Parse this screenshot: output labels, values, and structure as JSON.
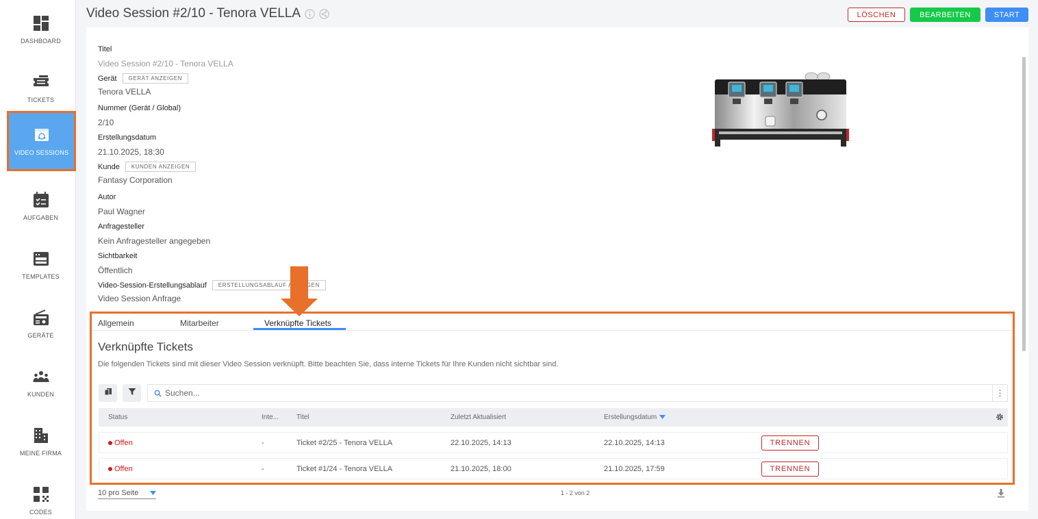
{
  "sidebar": {
    "items": [
      {
        "label": "DASHBOARD",
        "icon": "dashboard-icon"
      },
      {
        "label": "TICKETS",
        "icon": "ticket-icon"
      },
      {
        "label": "VIDEO SESSIONS",
        "icon": "video-session-icon",
        "active": true
      },
      {
        "label": "AUFGABEN",
        "icon": "calendar-check-icon"
      },
      {
        "label": "TEMPLATES",
        "icon": "template-icon"
      },
      {
        "label": "GERÄTE",
        "icon": "radio-device-icon"
      },
      {
        "label": "KUNDEN",
        "icon": "people-icon"
      },
      {
        "label": "MEINE FIRMA",
        "icon": "building-icon"
      },
      {
        "label": "CODES",
        "icon": "qr-code-icon"
      }
    ]
  },
  "header": {
    "title": "Video Session #2/10 - Tenora VELLA",
    "delete_label": "LÖSCHEN",
    "edit_label": "BEARBEITEN",
    "start_label": "START"
  },
  "details": {
    "titel": {
      "label": "Titel",
      "value": "Video Session #2/10 - Tenora VELLA"
    },
    "geraet": {
      "label": "Gerät",
      "button": "GERÄT ANZEIGEN",
      "value": "Tenora VELLA"
    },
    "nummer": {
      "label": "Nummer (Gerät / Global)",
      "value": "2/10"
    },
    "erstellungsdatum": {
      "label": "Erstellungsdatum",
      "value": "21.10.2025, 18:30"
    },
    "kunde": {
      "label": "Kunde",
      "button": "KUNDEN ANZEIGEN",
      "value": "Fantasy Corporation"
    },
    "autor": {
      "label": "Autor",
      "value": "Paul Wagner"
    },
    "anfragesteller": {
      "label": "Anfragesteller",
      "value": "Kein Anfragesteller angegeben"
    },
    "sichtbarkeit": {
      "label": "Sichtbarkeit",
      "value": "Öffentlich"
    },
    "ablauf": {
      "label": "Video-Session-Erstellungsablauf",
      "button": "ERSTELLUNGSABLAUF ANZEIGEN",
      "value": "Video Session Anfrage"
    }
  },
  "tabs": [
    {
      "label": "Allgemein"
    },
    {
      "label": "Mitarbeiter"
    },
    {
      "label": "Verknüpfte Tickets",
      "active": true
    }
  ],
  "linked": {
    "title": "Verknüpfte Tickets",
    "description": "Die folgenden Tickets sind mit dieser Video Session verknüpft. Bitte beachten Sie, dass interne Tickets für Ihre Kunden nicht sichtbar sind.",
    "search_placeholder": "Suchen...",
    "columns": {
      "status": "Status",
      "intern": "Inte...",
      "titel": "Titel",
      "updated": "Zuletzt Aktualisiert",
      "created": "Erstellungsdatum"
    },
    "rows": [
      {
        "status": "Offen",
        "intern": "-",
        "titel": "Ticket #2/25 - Tenora VELLA",
        "updated": "22.10.2025, 14:13",
        "created": "22.10.2025, 14:13",
        "action": "TRENNEN"
      },
      {
        "status": "Offen",
        "intern": "-",
        "titel": "Ticket #1/24 - Tenora VELLA",
        "updated": "21.10.2025, 18:00",
        "created": "21.10.2025, 17:59",
        "action": "TRENNEN"
      }
    ],
    "per_page": "10 pro Seite",
    "pagination": "1 - 2 von 2"
  },
  "colors": {
    "accent": "#3d8ef5",
    "active_nav": "#5aa7f0",
    "highlight": "#e8702a",
    "success": "#17c94a",
    "danger": "#c0282d",
    "status_open": "#d11a1a"
  }
}
